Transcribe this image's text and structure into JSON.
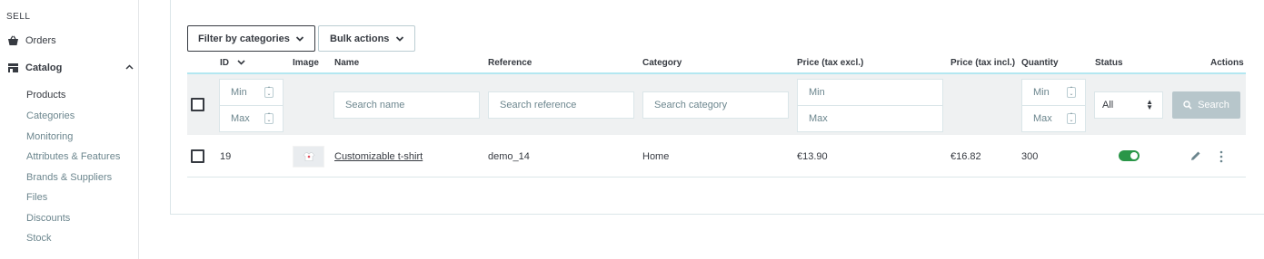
{
  "sidebar": {
    "section": "SELL",
    "orders": "Orders",
    "catalog": "Catalog",
    "items": [
      {
        "label": "Products",
        "active": true
      },
      {
        "label": "Categories"
      },
      {
        "label": "Monitoring"
      },
      {
        "label": "Attributes & Features"
      },
      {
        "label": "Brands & Suppliers"
      },
      {
        "label": "Files"
      },
      {
        "label": "Discounts"
      },
      {
        "label": "Stock"
      }
    ]
  },
  "toolbar": {
    "filter_label": "Filter by categories",
    "bulk_label": "Bulk actions"
  },
  "table": {
    "headers": {
      "id": "ID",
      "image": "Image",
      "name": "Name",
      "reference": "Reference",
      "category": "Category",
      "price_excl": "Price (tax excl.)",
      "price_incl": "Price (tax incl.)",
      "quantity": "Quantity",
      "status": "Status",
      "actions": "Actions"
    },
    "filters": {
      "id_min": "Min",
      "id_max": "Max",
      "name_placeholder": "Search name",
      "reference_placeholder": "Search reference",
      "category_placeholder": "Search category",
      "price_min": "Min",
      "price_max": "Max",
      "qty_min": "Min",
      "qty_max": "Max",
      "status_value": "All",
      "search_label": "Search"
    },
    "rows": [
      {
        "id": "19",
        "name": "Customizable t-shirt",
        "reference": "demo_14",
        "category": "Home",
        "price_excl": "€13.90",
        "price_incl": "€16.82",
        "quantity": "300",
        "status_enabled": true
      }
    ]
  },
  "colors": {
    "toggle_on": "#2a9648",
    "search_button": "#b7c6cb",
    "accent": "#25b9d7"
  }
}
